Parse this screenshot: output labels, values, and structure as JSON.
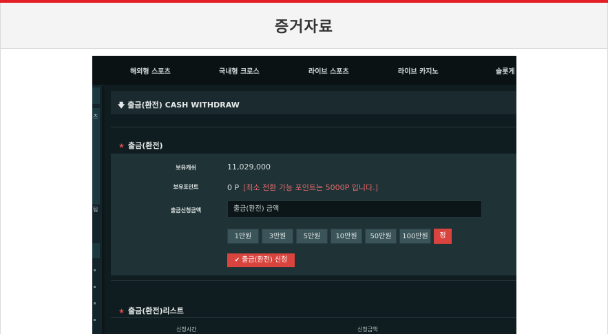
{
  "page": {
    "title": "증거자료"
  },
  "nav": {
    "items": [
      "해외형 스포츠",
      "국내형 크로스",
      "라이브 스포츠",
      "라이브 카지노",
      "슬롯게"
    ]
  },
  "sidebar": {
    "fragments": [
      "츠",
      "팀"
    ]
  },
  "withdraw": {
    "header": "출금(환전) CASH WITHDRAW",
    "section_title": "출금(환전)",
    "balance_label": "보유캐쉬",
    "balance_value": "11,029,000",
    "points_label": "보유포인트",
    "points_value": "0 P",
    "points_note": "[최소 전환 가능 포인트는 5000P 입니다.]",
    "amount_label": "출금신청금액",
    "amount_placeholder": "출금(환전) 금액",
    "amount_buttons": [
      "1만원",
      "3만원",
      "5만원",
      "10만원",
      "50만원",
      "100만원"
    ],
    "reset_label": "정",
    "submit_label": "출금(환전) 신청"
  },
  "list": {
    "title": "출금(환전)리스트",
    "columns": [
      "신청시간",
      "신청금액"
    ]
  },
  "colors": {
    "accent_red": "#d9443e",
    "top_bar": "#e31e24",
    "dark_bg": "#0d1719"
  }
}
